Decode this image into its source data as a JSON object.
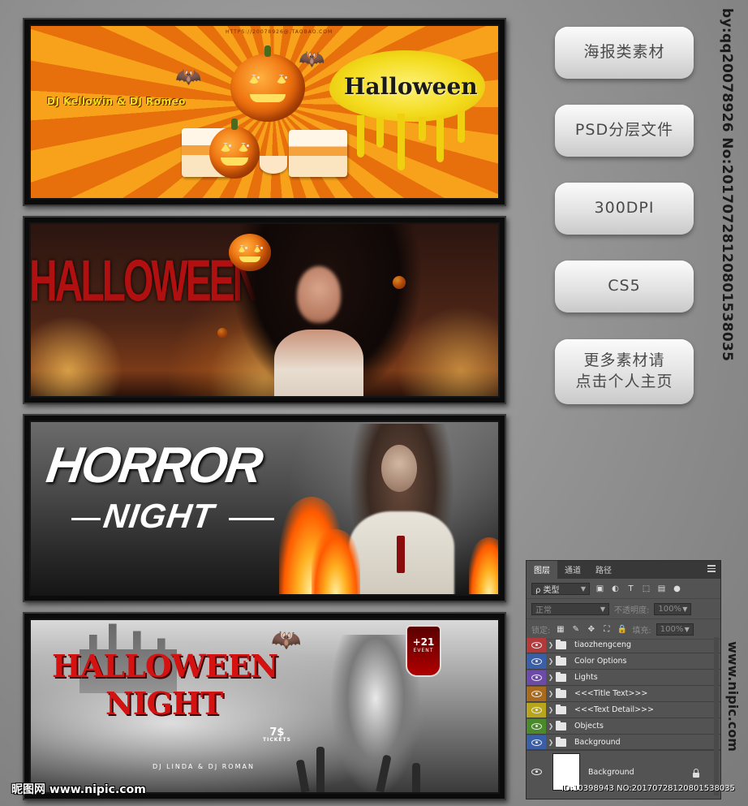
{
  "posters": {
    "p1": {
      "dj": "DJ Kellowin  & DJ Romeo",
      "title": "Halloween",
      "url_text": "HTTPS://20078926@.TAOBAO.COM"
    },
    "p2": {
      "title": "HALLOWEEN"
    },
    "p3": {
      "title": "HORROR",
      "subtitle": "NIGHT"
    },
    "p4": {
      "title_line1": "HALLOWEEN",
      "title_line2": "NIGHT",
      "djs": "DJ LINDA  &  DJ ROMAN",
      "price": "7$",
      "tickets": "TICKETS",
      "badge_big": "+21",
      "badge_small": "EVENT"
    }
  },
  "buttons": [
    "海报类素材",
    "PSD分层文件",
    "300DPI",
    "CS5",
    "更多素材请\n点击个人主页"
  ],
  "side_text": "by:qq20078926 No:20170728120801538035",
  "side_text_bottom": "www.nipic.com",
  "watermark_left": "昵图网 www.nipic.com",
  "watermark_id": "ID:10398943 NO:20170728120801538035",
  "layers_panel": {
    "tabs": [
      "图层",
      "通道",
      "路径"
    ],
    "filter_label": "ρ 类型",
    "blend_mode": "正常",
    "opacity_label": "不透明度:",
    "opacity_value": "100%",
    "lock_label": "锁定:",
    "fill_label": "填充:",
    "fill_value": "100%",
    "layers": [
      {
        "name": "tiaozhengceng",
        "color": "#b23a3a"
      },
      {
        "name": "Color Options",
        "color": "#3a5fa6"
      },
      {
        "name": "Lights",
        "color": "#6d49a8"
      },
      {
        "name": "<<<Title Text>>>",
        "color": "#a86a1e"
      },
      {
        "name": "<<<Text Detail>>>",
        "color": "#b8a51c"
      },
      {
        "name": "Objects",
        "color": "#4a8a2a"
      },
      {
        "name": "Background",
        "color": "#3a5fa6"
      }
    ],
    "background_layer": "Background"
  },
  "colors": {
    "poster1_orange": "#f08a12",
    "poster_red": "#c41414",
    "panel_bg": "#535353"
  }
}
